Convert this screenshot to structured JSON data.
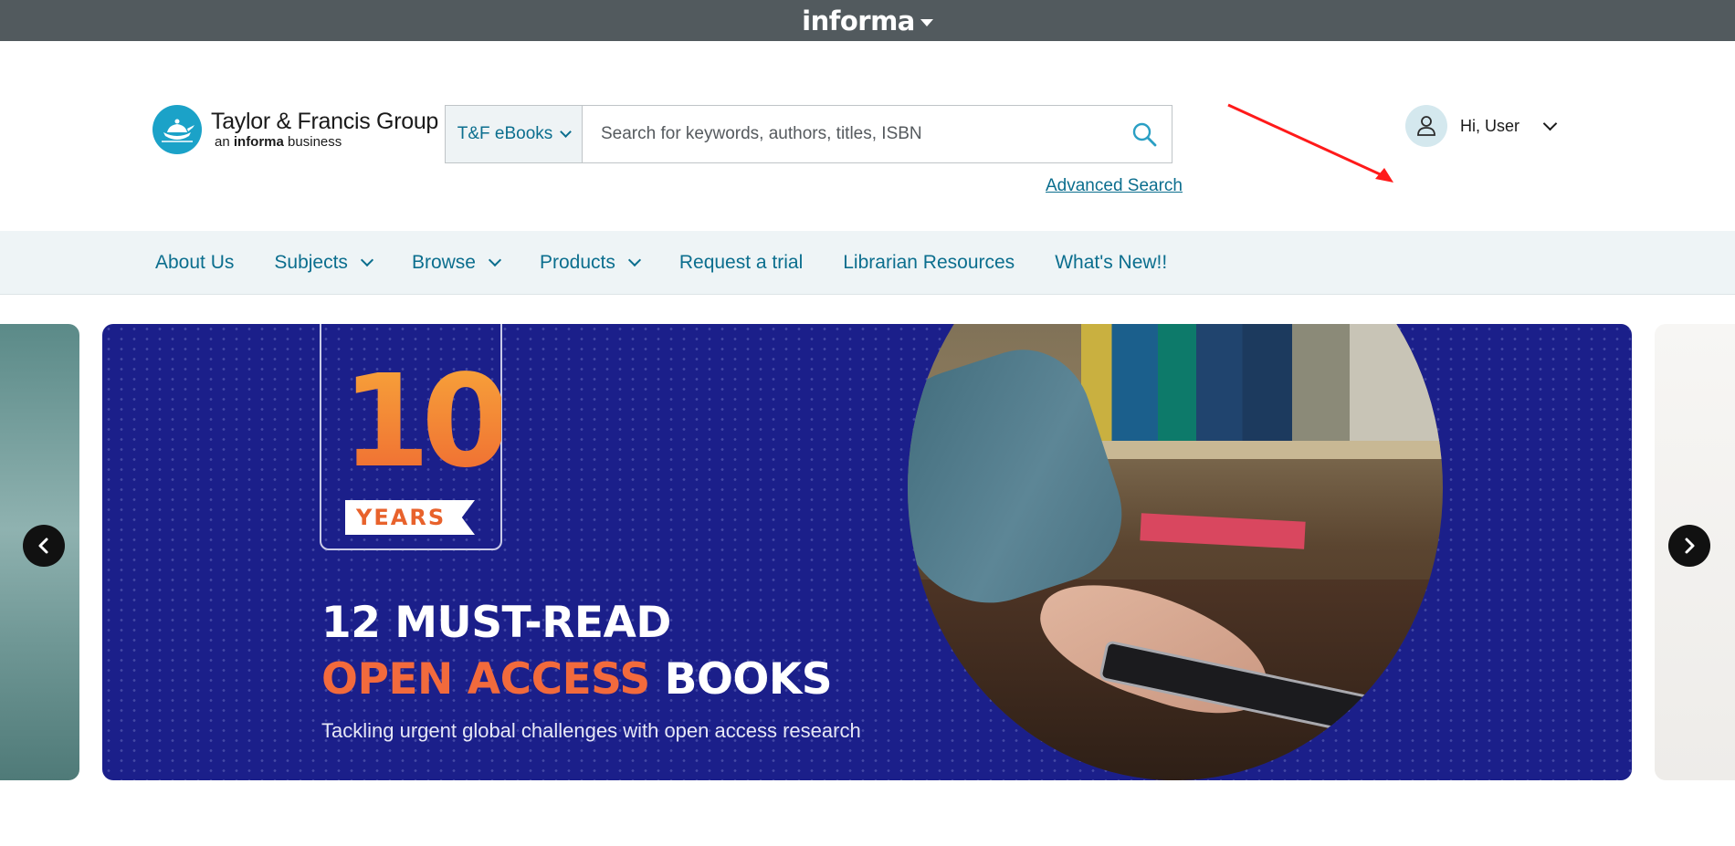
{
  "informa_bar": {
    "brand": "informa"
  },
  "header": {
    "logo": {
      "title": "Taylor & Francis Group",
      "sub_prefix": "an",
      "sub_bold": "informa",
      "sub_suffix": "business"
    },
    "search": {
      "scope": "T&F eBooks",
      "placeholder": "Search for keywords, authors, titles, ISBN",
      "value": ""
    },
    "advanced_search": "Advanced Search",
    "user": {
      "greeting": "Hi, User"
    }
  },
  "nav": {
    "items": [
      {
        "label": "About Us",
        "dropdown": false
      },
      {
        "label": "Subjects",
        "dropdown": true
      },
      {
        "label": "Browse",
        "dropdown": true
      },
      {
        "label": "Products",
        "dropdown": true
      },
      {
        "label": "Request a trial",
        "dropdown": false
      },
      {
        "label": "Librarian Resources",
        "dropdown": false
      },
      {
        "label": "What's New!!",
        "dropdown": false
      }
    ]
  },
  "banner": {
    "number": "10",
    "years": "YEARS",
    "headline_line1": "12 MUST-READ",
    "headline_orange": "OPEN ACCESS",
    "headline_white": "BOOKS",
    "tagline": "Tackling urgent global challenges with open access research"
  },
  "colors": {
    "informa_bar": "#525a5e",
    "link_teal": "#0b6e8e",
    "nav_bg": "#eef4f6",
    "banner_navy": "#1b1f8a",
    "banner_orange": "#f26a3c",
    "annotation_red": "#ff1a1a"
  },
  "icons": [
    "caret-down-icon",
    "chevron-down-icon",
    "search-icon",
    "user-icon",
    "chevron-left-icon",
    "chevron-right-icon",
    "annotation-arrow-icon"
  ]
}
